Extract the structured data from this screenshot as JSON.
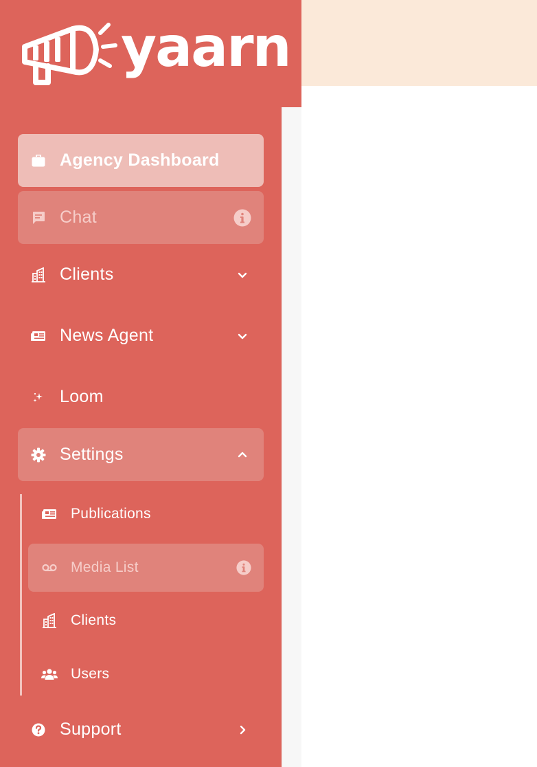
{
  "brand": {
    "name": "yaarn"
  },
  "colors": {
    "sidebar": "#dd645b",
    "active_item": "#eebdb7",
    "muted_item": "#e0837b",
    "topbar": "#fbe9d9"
  },
  "nav": {
    "agency_dashboard": {
      "label": "Agency Dashboard",
      "icon": "briefcase-icon"
    },
    "chat": {
      "label": "Chat",
      "icon": "message-icon",
      "badge": "info-icon"
    },
    "clients": {
      "label": "Clients",
      "icon": "building-icon",
      "chevron": "chevron-down-icon"
    },
    "news_agent": {
      "label": "News Agent",
      "icon": "newspaper-icon",
      "chevron": "chevron-down-icon"
    },
    "loom": {
      "label": "Loom",
      "icon": "sparkle-icon"
    },
    "settings": {
      "label": "Settings",
      "icon": "gear-icon",
      "chevron": "chevron-up-icon",
      "children": {
        "publications": {
          "label": "Publications",
          "icon": "newspaper-icon"
        },
        "media_list": {
          "label": "Media List",
          "icon": "voicemail-icon",
          "badge": "info-icon"
        },
        "clients": {
          "label": "Clients",
          "icon": "building-icon"
        },
        "users": {
          "label": "Users",
          "icon": "users-icon"
        }
      }
    },
    "support": {
      "label": "Support",
      "icon": "question-circle-icon",
      "chevron": "chevron-right-icon"
    }
  }
}
